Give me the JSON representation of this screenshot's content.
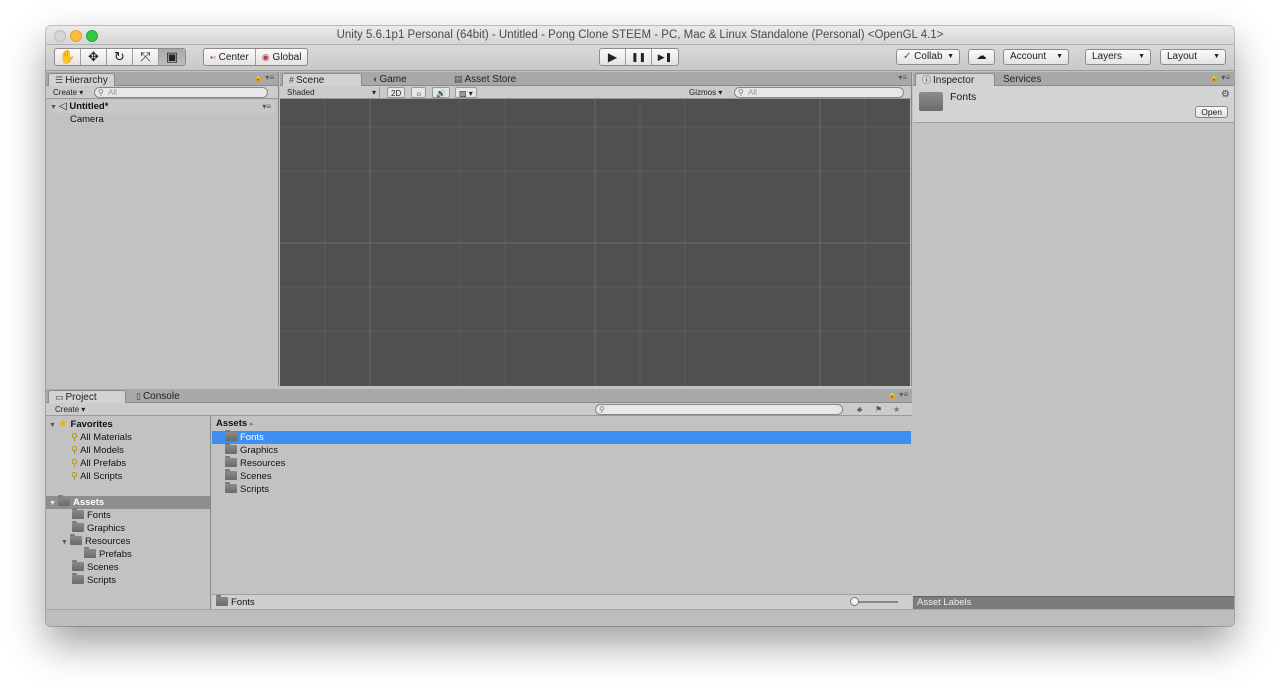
{
  "window": {
    "title": "Unity 5.6.1p1 Personal (64bit) - Untitled - Pong Clone STEEM - PC, Mac & Linux Standalone (Personal) <OpenGL 4.1>"
  },
  "toolbar": {
    "tools": [
      {
        "name": "hand-tool",
        "icon": "✋"
      },
      {
        "name": "move-tool",
        "icon": "✥"
      },
      {
        "name": "rotate-tool",
        "icon": "↻"
      },
      {
        "name": "scale-tool",
        "icon": "⤧"
      },
      {
        "name": "rect-tool",
        "icon": "▣"
      }
    ],
    "pivot_mode": "Center",
    "pivot_rotation": "Global",
    "play_icons": [
      "▶",
      "❚❚",
      "▶❚"
    ],
    "collab": "Collab",
    "account": "Account",
    "layers": "Layers",
    "layout": "Layout"
  },
  "hierarchy": {
    "tab": "Hierarchy",
    "create": "Create",
    "search_placeholder": "All",
    "scene": "Untitled*",
    "items": [
      "Camera"
    ]
  },
  "scene_panel": {
    "tabs": [
      "Scene",
      "Game",
      "Asset Store"
    ],
    "shading": "Shaded",
    "mode_2d": "2D",
    "gizmos": "Gizmos",
    "search_placeholder": "All"
  },
  "inspector": {
    "tabs": [
      "Inspector",
      "Services"
    ],
    "title": "Fonts",
    "open_label": "Open",
    "asset_labels": "Asset Labels"
  },
  "project": {
    "tabs": [
      "Project",
      "Console"
    ],
    "create": "Create",
    "favorites_label": "Favorites",
    "favorites": [
      "All Materials",
      "All Models",
      "All Prefabs",
      "All Scripts"
    ],
    "assets_label": "Assets",
    "tree": [
      "Fonts",
      "Graphics",
      "Resources",
      "Prefabs",
      "Scenes",
      "Scripts"
    ],
    "breadcrumb": "Assets",
    "files": [
      "Fonts",
      "Graphics",
      "Resources",
      "Scenes",
      "Scripts"
    ],
    "selected": "Fonts",
    "footer_path": "Fonts"
  }
}
